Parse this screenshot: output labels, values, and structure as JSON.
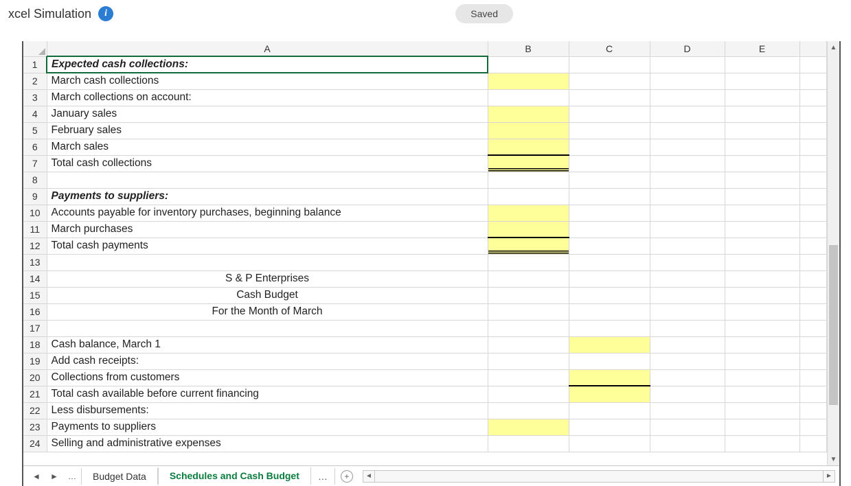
{
  "header": {
    "title": "xcel Simulation",
    "saved_label": "Saved"
  },
  "columns": [
    "A",
    "B",
    "C",
    "D",
    "E"
  ],
  "rows": [
    {
      "n": 1,
      "a": "Expected cash collections:",
      "style": "bold-italic",
      "selected": true
    },
    {
      "n": 2,
      "a": "March cash collections",
      "b_hl": true
    },
    {
      "n": 3,
      "a": "March collections on account:"
    },
    {
      "n": 4,
      "a": "January sales",
      "indent": 1,
      "b_hl": true
    },
    {
      "n": 5,
      "a": "February sales",
      "indent": 1,
      "b_hl": true
    },
    {
      "n": 6,
      "a": "March sales",
      "indent": 1,
      "b_hl": true,
      "b_under": "single"
    },
    {
      "n": 7,
      "a": "Total cash collections",
      "b_hl": true,
      "b_under": "double"
    },
    {
      "n": 8,
      "a": ""
    },
    {
      "n": 9,
      "a": "Payments to suppliers:",
      "style": "bold-italic"
    },
    {
      "n": 10,
      "a": "Accounts payable for inventory purchases, beginning balance",
      "b_hl": true
    },
    {
      "n": 11,
      "a": "March purchases",
      "b_hl": true,
      "b_under": "single"
    },
    {
      "n": 12,
      "a": "Total cash payments",
      "b_hl": true,
      "b_under": "double"
    },
    {
      "n": 13,
      "a": ""
    },
    {
      "n": 14,
      "a": "S & P Enterprises",
      "center": true
    },
    {
      "n": 15,
      "a": "Cash Budget",
      "center": true
    },
    {
      "n": 16,
      "a": "For the Month of March",
      "center": true
    },
    {
      "n": 17,
      "a": ""
    },
    {
      "n": 18,
      "a": "Cash balance, March 1",
      "c_hl": true
    },
    {
      "n": 19,
      "a": "Add cash receipts:"
    },
    {
      "n": 20,
      "a": "Collections from customers",
      "indent": 1,
      "c_hl": true,
      "c_under": "single"
    },
    {
      "n": 21,
      "a": "Total cash available before current financing",
      "c_hl": true
    },
    {
      "n": 22,
      "a": "Less disbursements:"
    },
    {
      "n": 23,
      "a": "Payments to suppliers",
      "indent": 1,
      "b_hl": true
    },
    {
      "n": 24,
      "a": "Selling and administrative expenses",
      "indent": 1
    }
  ],
  "tabs": {
    "inactive": "Budget Data",
    "active": "Schedules and Cash Budget"
  }
}
